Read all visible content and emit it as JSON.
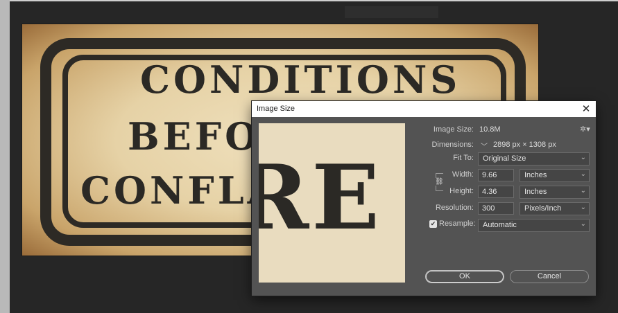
{
  "canvas": {
    "sign_lines": [
      "CONDITIONS",
      "BEFORE",
      "CONFLAGRATION"
    ]
  },
  "dialog": {
    "title": "Image Size",
    "close_icon": "close-icon",
    "preview_text": "RE",
    "image_size_label": "Image Size:",
    "image_size_value": "10.8M",
    "dimensions_label": "Dimensions:",
    "dimensions_value": "2898 px  ×  1308 px",
    "fit_to_label": "Fit To:",
    "fit_to_value": "Original Size",
    "width_label": "Width:",
    "width_value": "9.66",
    "width_unit": "Inches",
    "height_label": "Height:",
    "height_value": "4.36",
    "height_unit": "Inches",
    "resolution_label": "Resolution:",
    "resolution_value": "300",
    "resolution_unit": "Pixels/Inch",
    "resample_label": "Resample:",
    "resample_checked": true,
    "resample_value": "Automatic",
    "ok_label": "OK",
    "cancel_label": "Cancel",
    "gear_icon": "gear-icon",
    "link_icon": "chain-link-icon"
  },
  "colors": {
    "workspace": "#262626",
    "dialog_bg": "#535353",
    "ink": "#2b2925",
    "parchment": "#e6d2a6"
  }
}
